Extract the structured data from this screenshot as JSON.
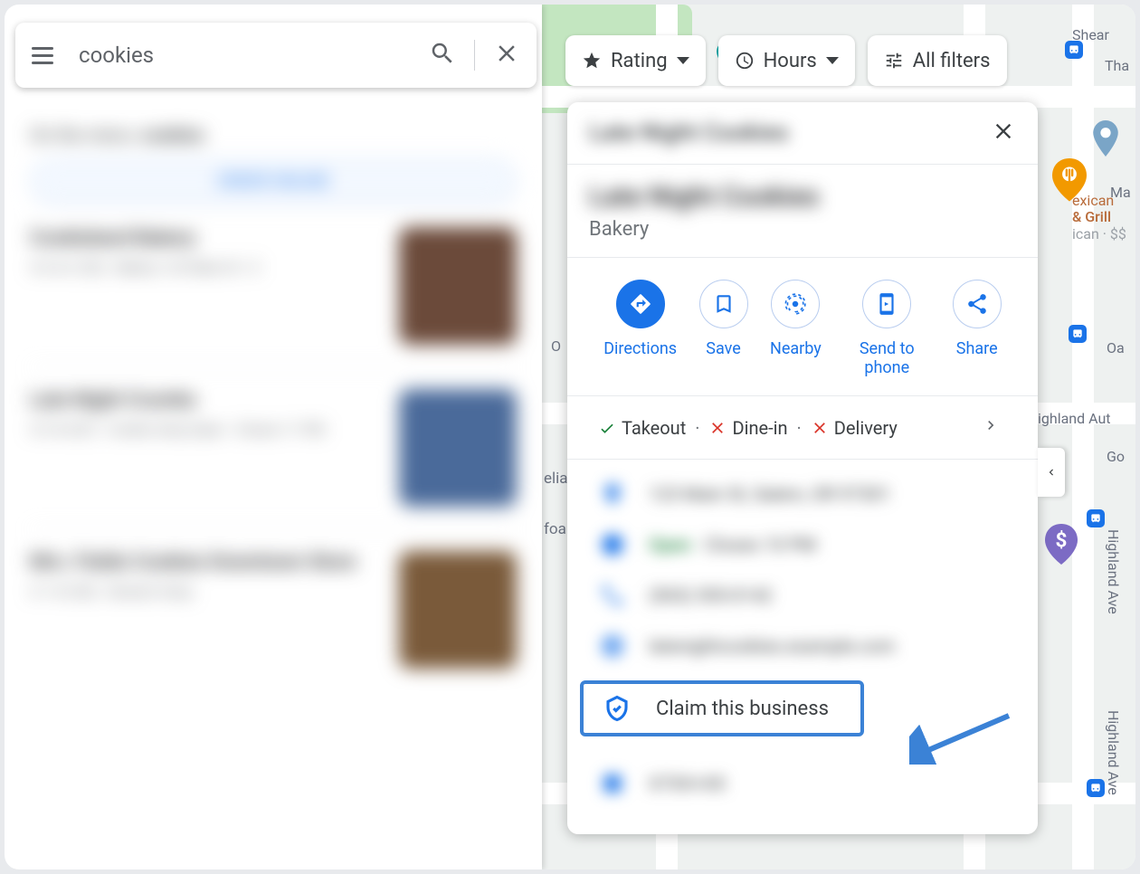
{
  "search": {
    "query": "cookies"
  },
  "filters": {
    "rating": "Rating",
    "hours": "Hours",
    "all": "All filters"
  },
  "sidebar": {
    "on_menu_prefix": "On the menu: ",
    "on_menu_term": "cookies",
    "order_label": "ORDER ONLINE",
    "results": [
      {
        "title": "Cookieland Bakery",
        "sub": "4.6 ★ (120) · Bakery\n123 Main St · $"
      },
      {
        "title": "Late Night Crumbs",
        "sub": "4.3 ★ (87) · Cookie shop\nOpen · Closes 11 PM"
      },
      {
        "title": "Mrs. Fields Cookies Downtown Store",
        "sub": "4.1 ★ (54) · Dessert shop"
      }
    ]
  },
  "detail": {
    "header_title": "Late Night Cookies",
    "name": "Late Night Cookies",
    "category": "Bakery",
    "actions": {
      "directions": "Directions",
      "save": "Save",
      "nearby": "Nearby",
      "send": "Send to phone",
      "share": "Share"
    },
    "services": {
      "takeout": "Takeout",
      "dinein": "Dine-in",
      "delivery": "Delivery"
    },
    "info": {
      "address": "123 Main St, Salem, OR 97301",
      "hours_open": "Open",
      "hours_rest": " · Closes 10 PM",
      "phone": "(503) 555-0142",
      "website": "latenightcookies.example.com",
      "claim": "Claim this business",
      "plus": "X7XX+XX"
    }
  },
  "map": {
    "labels": {
      "shear": "Shear",
      "tha": "Tha",
      "ma": "Ma",
      "go": "Go",
      "oa": "Oa",
      "o": "O",
      "highland_auto": "ighland Aut",
      "highland_ave_1": "Highland Ave",
      "highland_ave_2": "Highland Ave",
      "reliab": "eliab",
      "foa": "foa"
    },
    "poi": {
      "mexican_line1": "exican",
      "mexican_line2": "& Grill",
      "mexican_sub": "ican · $$"
    }
  }
}
